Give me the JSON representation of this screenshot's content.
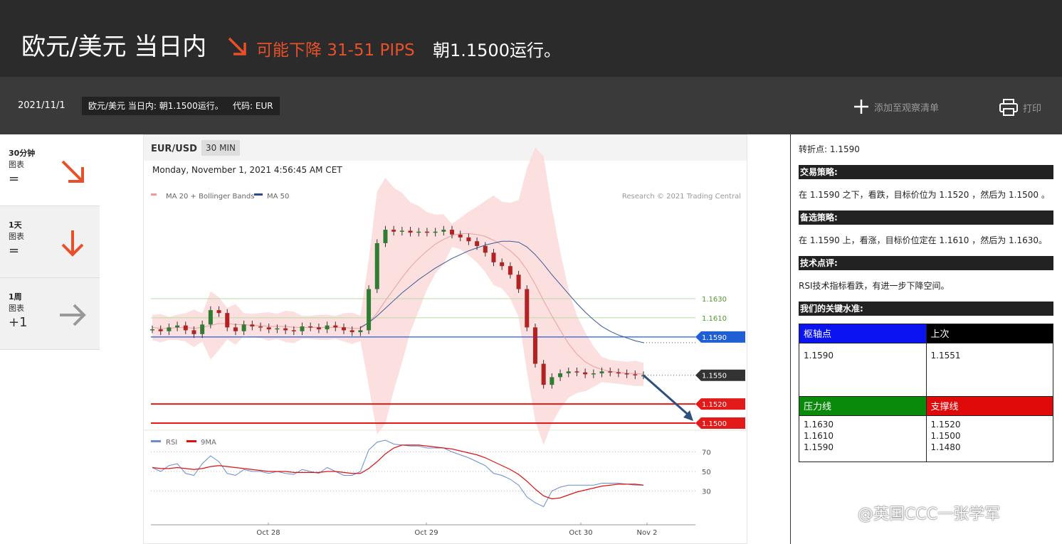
{
  "header": {
    "title": "欧元/美元 当日内",
    "direction_text": "可能下降 31-51 PIPS",
    "target_text": "朝1.1500运行。",
    "accent_color": "#e8502a"
  },
  "subbar": {
    "date": "2021/11/1",
    "chip_title": "欧元/美元 当日内: 朝1.1500运行。",
    "chip_code": "代码: EUR",
    "watchlist_label": "添加至观察清单",
    "print_label": "打印"
  },
  "timeframes": [
    {
      "label": "30分钟",
      "sub": "图表",
      "score": "=",
      "arrow": "down-right-arrow",
      "color": "#e8502a"
    },
    {
      "label": "1天",
      "sub": "图表",
      "score": "=",
      "arrow": "down-arrow",
      "color": "#e8502a"
    },
    {
      "label": "1周",
      "sub": "图表",
      "score": "+1",
      "arrow": "right-arrow",
      "color": "#999999"
    }
  ],
  "chart": {
    "pair": "EUR/USD",
    "timeframe": "30 MIN",
    "timestamp": "Monday, November 1, 2021 4:56:45 AM CET",
    "legend_ma20": "MA 20 + Bollinger Bands",
    "legend_ma50": "MA 50",
    "credit": "Research © 2021 Trading Central",
    "rsi_legend": "RSI",
    "rsi_ma_legend": "9MA"
  },
  "chart_data": {
    "type": "line",
    "x_ticks": [
      "Oct 28",
      "Oct 29",
      "Oct 30",
      "Nov 2"
    ],
    "price_levels": [
      {
        "label": "1.1630",
        "value": 1.163,
        "kind": "resistance",
        "color": "#4f9a2a"
      },
      {
        "label": "1.1610",
        "value": 1.161,
        "kind": "resistance",
        "color": "#4f9a2a"
      },
      {
        "label": "1.1590",
        "value": 1.159,
        "kind": "pivot",
        "color": "#1f5fd6"
      },
      {
        "label": "1.1550",
        "value": 1.155,
        "kind": "last",
        "color": "#333333"
      },
      {
        "label": "1.1520",
        "value": 1.152,
        "kind": "target",
        "color": "#e21a1a"
      },
      {
        "label": "1.1500",
        "value": 1.15,
        "kind": "target",
        "color": "#e21a1a"
      }
    ],
    "price_close": [
      1.1598,
      1.1596,
      1.16,
      1.1602,
      1.1597,
      1.1593,
      1.1603,
      1.1618,
      1.1615,
      1.16,
      1.1596,
      1.1603,
      1.1601,
      1.16,
      1.1598,
      1.1599,
      1.1597,
      1.1596,
      1.1601,
      1.16,
      1.1598,
      1.1602,
      1.16,
      1.1597,
      1.1595,
      1.1597,
      1.164,
      1.1688,
      1.1702,
      1.17,
      1.1701,
      1.1699,
      1.17,
      1.1699,
      1.17,
      1.1702,
      1.1697,
      1.1694,
      1.169,
      1.1685,
      1.1678,
      1.1668,
      1.1664,
      1.1655,
      1.164,
      1.16,
      1.1562,
      1.154,
      1.1548,
      1.1552,
      1.1554,
      1.1553,
      1.1551,
      1.1552,
      1.1554,
      1.1553,
      1.1552,
      1.1551,
      1.155,
      1.155
    ],
    "ma20": [
      1.16,
      1.1599,
      1.1599,
      1.16,
      1.16,
      1.1599,
      1.16,
      1.1602,
      1.1604,
      1.1604,
      1.1603,
      1.1603,
      1.1602,
      1.1602,
      1.1601,
      1.1601,
      1.1601,
      1.16,
      1.16,
      1.16,
      1.16,
      1.16,
      1.16,
      1.16,
      1.1599,
      1.1599,
      1.1605,
      1.1615,
      1.1628,
      1.164,
      1.1652,
      1.1663,
      1.1672,
      1.168,
      1.1687,
      1.1692,
      1.1696,
      1.1698,
      1.1698,
      1.1697,
      1.1695,
      1.1691,
      1.1686,
      1.168,
      1.1672,
      1.166,
      1.1645,
      1.1628,
      1.1612,
      1.1597,
      1.1583,
      1.1572,
      1.1564,
      1.1559,
      1.1556,
      1.1554,
      1.1553,
      1.1552,
      1.1552,
      1.1551
    ],
    "ma50": [
      null,
      null,
      null,
      null,
      null,
      null,
      null,
      null,
      null,
      null,
      null,
      null,
      null,
      null,
      null,
      null,
      null,
      null,
      null,
      null,
      null,
      null,
      null,
      null,
      null,
      1.16,
      1.1605,
      1.1612,
      1.162,
      1.1628,
      1.1636,
      1.1643,
      1.165,
      1.1656,
      1.1662,
      1.1667,
      1.1672,
      1.1676,
      1.168,
      1.1683,
      1.1686,
      1.1688,
      1.169,
      1.169,
      1.1689,
      1.1684,
      1.1676,
      1.1666,
      1.1655,
      1.1645,
      1.1635,
      1.1625,
      1.1616,
      1.1608,
      1.1601,
      1.1596,
      1.1592,
      1.1589,
      1.1586,
      1.1584
    ],
    "rsi": [
      54,
      50,
      56,
      58,
      48,
      46,
      58,
      66,
      60,
      48,
      46,
      52,
      50,
      50,
      48,
      50,
      48,
      47,
      52,
      50,
      48,
      54,
      50,
      46,
      46,
      50,
      72,
      80,
      82,
      78,
      77,
      76,
      76,
      74,
      74,
      74,
      70,
      67,
      64,
      60,
      56,
      48,
      46,
      42,
      36,
      24,
      18,
      14,
      30,
      34,
      36,
      36,
      36,
      36,
      38,
      38,
      38,
      37,
      36,
      36
    ],
    "rsi_ma": [
      54,
      53,
      53,
      54,
      53,
      52,
      53,
      55,
      56,
      55,
      54,
      53,
      52,
      51,
      50,
      50,
      50,
      49,
      49,
      49,
      49,
      50,
      50,
      49,
      48,
      48,
      53,
      60,
      68,
      74,
      77,
      77,
      77,
      76,
      75,
      74,
      73,
      71,
      69,
      67,
      64,
      60,
      56,
      52,
      47,
      40,
      32,
      25,
      22,
      23,
      26,
      29,
      31,
      33,
      35,
      36,
      37,
      37,
      37,
      36
    ],
    "rsi_ticks": [
      "70",
      "50",
      "30"
    ],
    "rsi_range": [
      10,
      90
    ]
  },
  "panel": {
    "pivot_text": "转折点: 1.1590",
    "strategy_title": "交易策略:",
    "strategy_text": "在 1.1590 之下，看跌，目标价位为 1.1520 ，然后为 1.1500 。",
    "alt_title": "备选策略:",
    "alt_text": "在 1.1590 上，看涨，目标价位定在 1.1610 ，然后为 1.1630。",
    "tech_title": "技术点评:",
    "tech_text": "RSI技术指标看跌，有进一步下降空间。",
    "levels_title": "我们的关键水准:",
    "table": {
      "pivot_h": "枢轴点",
      "last_h": "上次",
      "pivot_v": "1.1590",
      "last_v": "1.1551",
      "res_h": "压力线",
      "sup_h": "支撑线",
      "res_v": [
        "1.1630",
        "1.1610",
        "1.1590"
      ],
      "sup_v": [
        "1.1520",
        "1.1500",
        "1.1480"
      ],
      "colors": {
        "pivot": "#0a14f0",
        "last": "#000000",
        "res": "#0a8a0a",
        "sup": "#e00a0a"
      }
    }
  },
  "watermark": "@英国CCC一张学军"
}
